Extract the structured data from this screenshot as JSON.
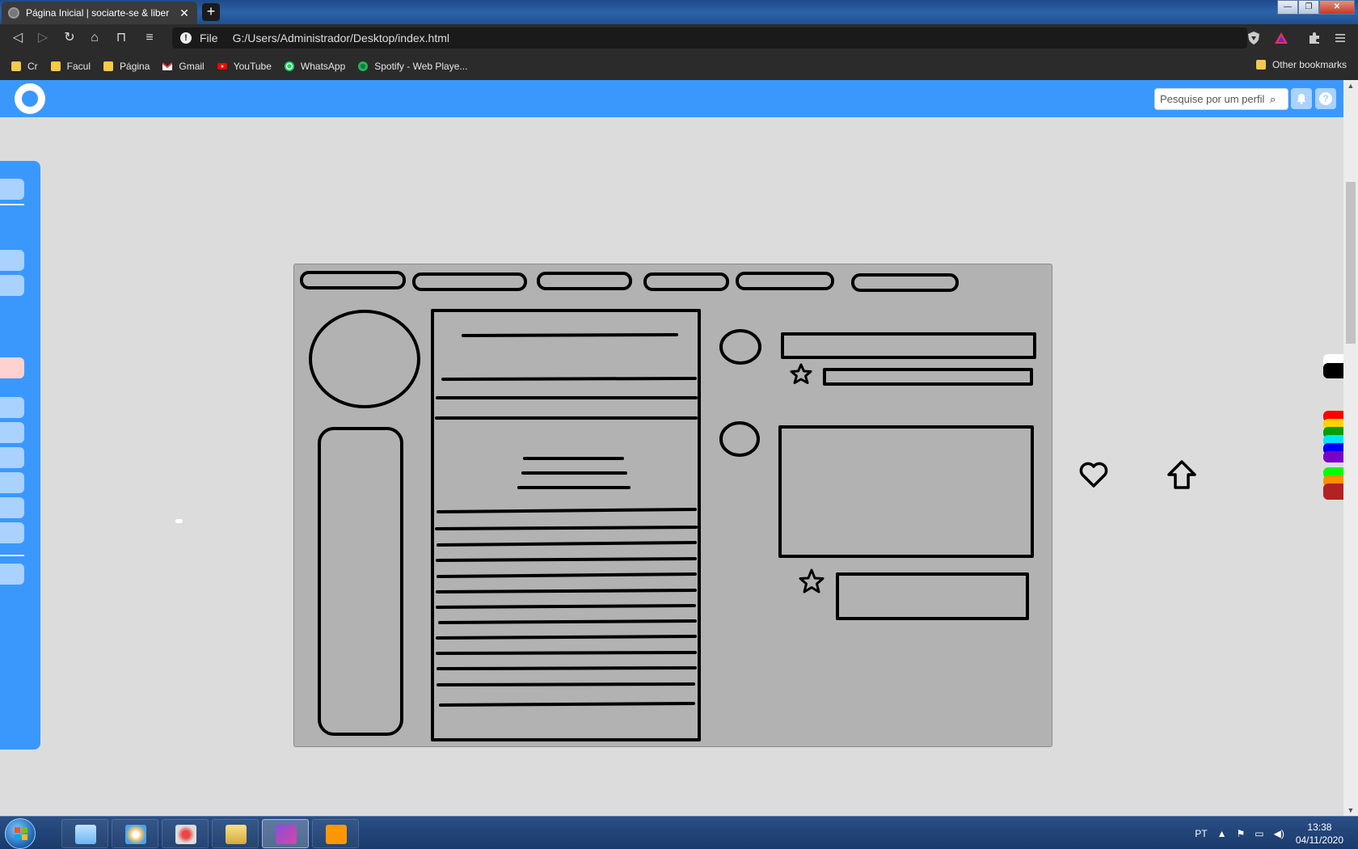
{
  "browser": {
    "tab_title": "Página Inicial | sociarte-se & liber",
    "tab_close": "✕",
    "new_tab": "+",
    "window_controls": {
      "minimize": "—",
      "maximize": "❐",
      "close": "✕"
    },
    "nav": {
      "back": "◁",
      "forward": "▷",
      "reload": "↻",
      "home": "⌂",
      "bookmark": "⊓",
      "reader": "≡"
    },
    "url_scheme": "File",
    "url": "G:/Users/Administrador/Desktop/index.html",
    "toolbar_icons": [
      "shield-icon",
      "triangle-alert-icon",
      "puzzle-icon",
      "menu-icon"
    ]
  },
  "bookmarks": {
    "items": [
      {
        "label": "Cr",
        "icon": "folder-icon"
      },
      {
        "label": "Facul",
        "icon": "folder-icon"
      },
      {
        "label": "Página",
        "icon": "folder-icon"
      },
      {
        "label": "Gmail",
        "icon": "gmail-icon"
      },
      {
        "label": "YouTube",
        "icon": "youtube-icon"
      },
      {
        "label": "WhatsApp",
        "icon": "whatsapp-icon"
      },
      {
        "label": "Spotify - Web Playe...",
        "icon": "spotify-icon"
      }
    ],
    "other": "Other bookmarks"
  },
  "site": {
    "search_placeholder": "Pesquise por um perfil",
    "search_icon": "⌕",
    "notification_icon": "🔔",
    "help_icon": "?"
  },
  "palette": [
    "#ffffff",
    "#000000",
    "#ff0000",
    "#ffd400",
    "#00a000",
    "#00e5ff",
    "#0000ff",
    "#7a00c8",
    "#00ff00",
    "#ff9000",
    "#b22222"
  ],
  "taskbar": {
    "language": "PT",
    "time": "13:38",
    "date": "04/11/2020"
  }
}
